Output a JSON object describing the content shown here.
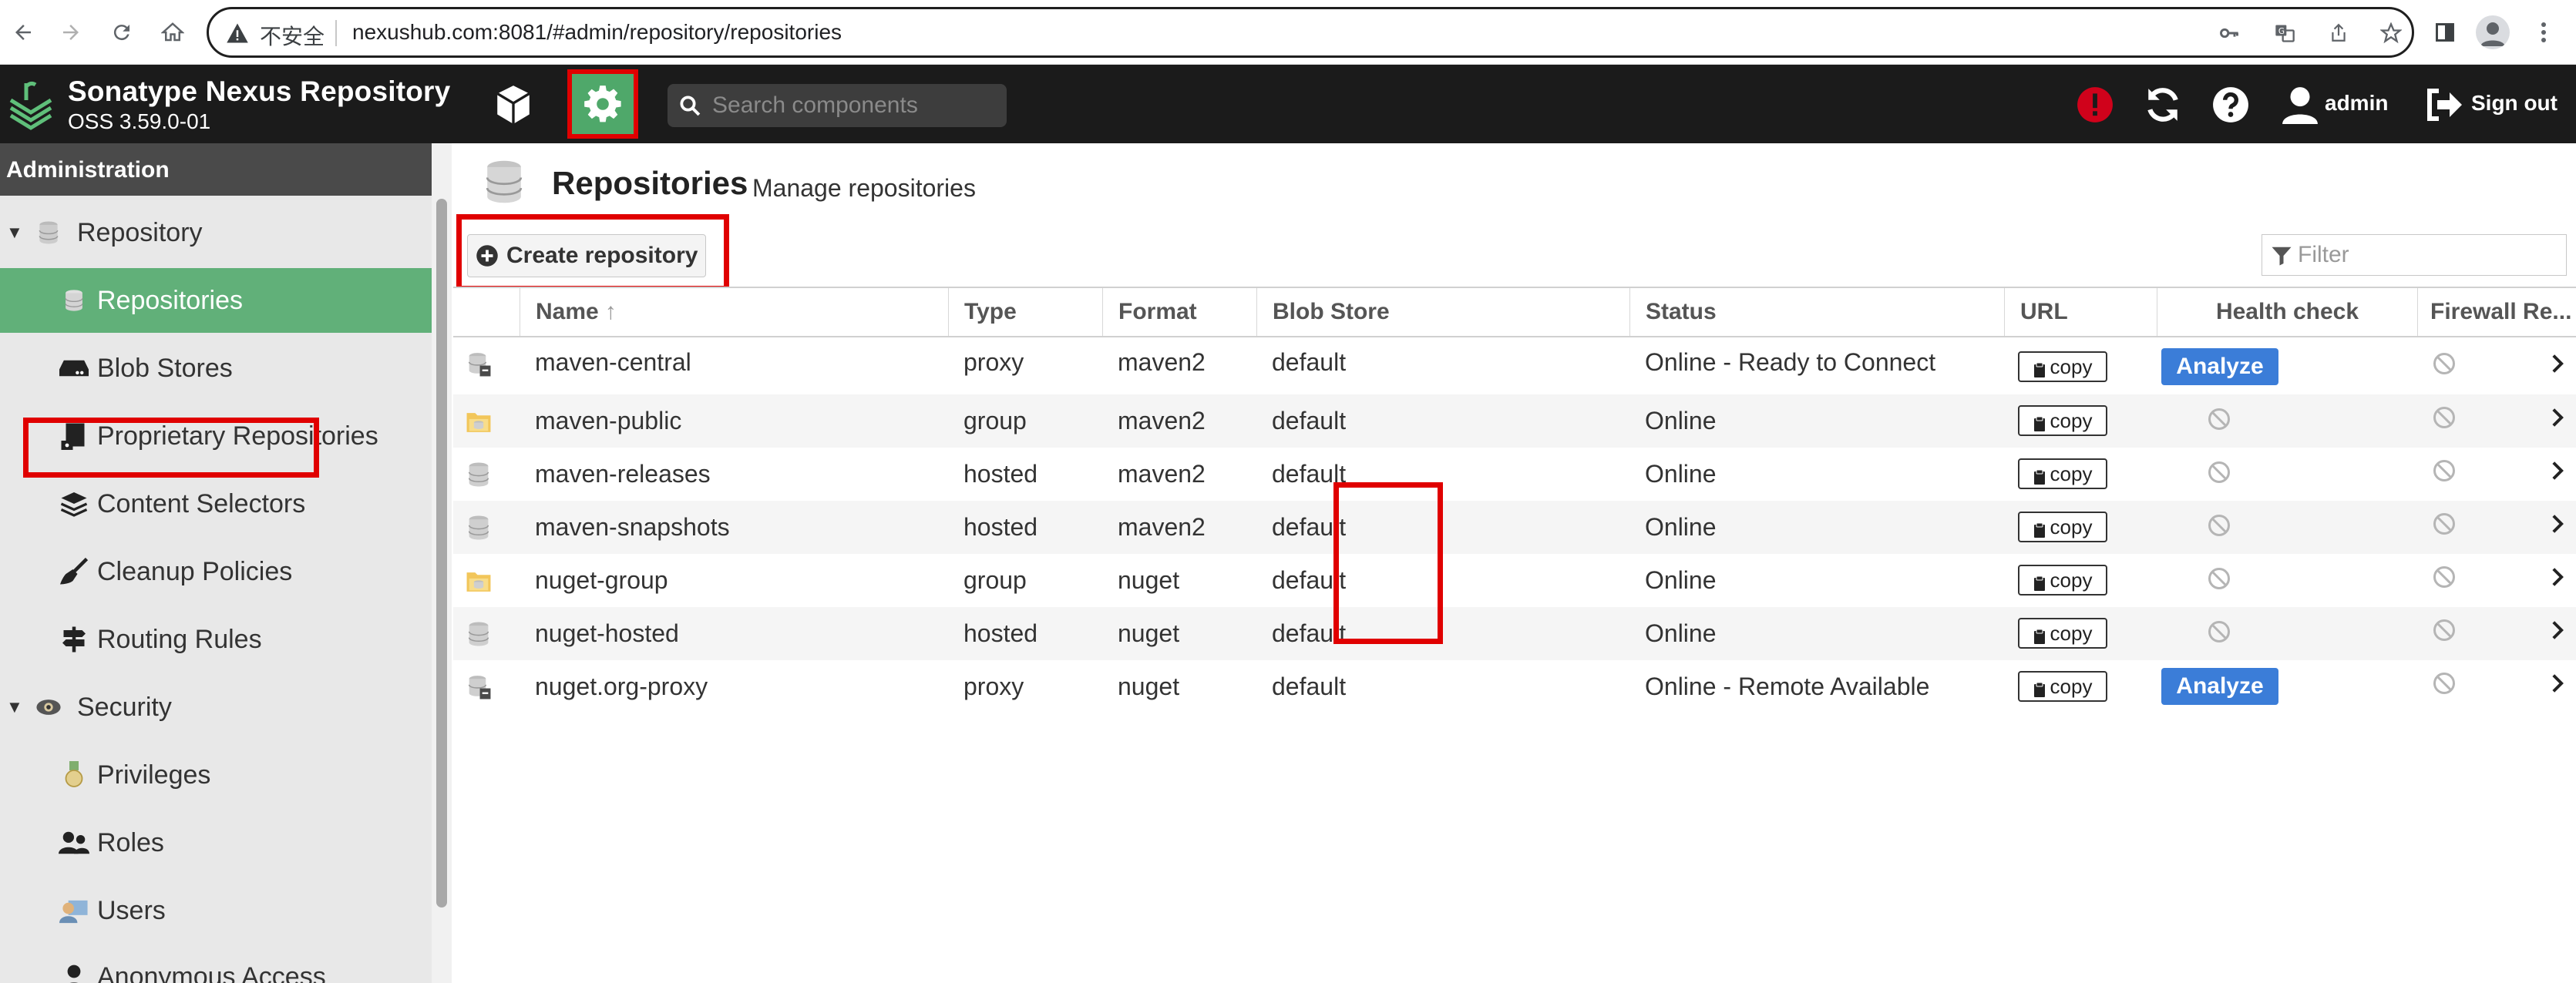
{
  "browser": {
    "insecure_label": "不安全",
    "url": "nexushub.com:8081/#admin/repository/repositories"
  },
  "app": {
    "brand": "Sonatype Nexus Repository",
    "version": "OSS 3.59.0-01",
    "search_placeholder": "Search components",
    "user": "admin",
    "sign_out": "Sign out"
  },
  "sidebar": {
    "title": "Administration",
    "groups": [
      {
        "label": "Repository",
        "items": [
          {
            "label": "Repositories",
            "icon": "database-icon",
            "active": true
          },
          {
            "label": "Blob Stores",
            "icon": "hard-drive-icon"
          },
          {
            "label": "Proprietary Repositories",
            "icon": "proprietary-icon"
          },
          {
            "label": "Content Selectors",
            "icon": "layers-icon"
          },
          {
            "label": "Cleanup Policies",
            "icon": "broom-icon"
          },
          {
            "label": "Routing Rules",
            "icon": "signpost-icon"
          }
        ]
      },
      {
        "label": "Security",
        "items": [
          {
            "label": "Privileges",
            "icon": "medal-icon"
          },
          {
            "label": "Roles",
            "icon": "users-icon"
          },
          {
            "label": "Users",
            "icon": "user-card-icon"
          },
          {
            "label": "Anonymous Access",
            "icon": "user-icon"
          }
        ]
      }
    ]
  },
  "page": {
    "title": "Repositories",
    "subtitle": "Manage repositories",
    "create_label": "Create repository",
    "filter_placeholder": "Filter"
  },
  "grid": {
    "columns": [
      "Name",
      "Type",
      "Format",
      "Blob Store",
      "Status",
      "URL",
      "Health check",
      "Firewall Re..."
    ],
    "sort_indicator": "↑",
    "copy_label": "copy",
    "analyze_label": "Analyze",
    "rows": [
      {
        "name": "maven-central",
        "type": "proxy",
        "format": "maven2",
        "blob_store": "default",
        "status": "Online - Ready to Connect",
        "health": "analyze",
        "kind": "proxy"
      },
      {
        "name": "maven-public",
        "type": "group",
        "format": "maven2",
        "blob_store": "default",
        "status": "Online",
        "health": "none",
        "kind": "group"
      },
      {
        "name": "maven-releases",
        "type": "hosted",
        "format": "maven2",
        "blob_store": "default",
        "status": "Online",
        "health": "none",
        "kind": "hosted"
      },
      {
        "name": "maven-snapshots",
        "type": "hosted",
        "format": "maven2",
        "blob_store": "default",
        "status": "Online",
        "health": "none",
        "kind": "hosted"
      },
      {
        "name": "nuget-group",
        "type": "group",
        "format": "nuget",
        "blob_store": "default",
        "status": "Online",
        "health": "none",
        "kind": "group"
      },
      {
        "name": "nuget-hosted",
        "type": "hosted",
        "format": "nuget",
        "blob_store": "default",
        "status": "Online",
        "health": "none",
        "kind": "hosted"
      },
      {
        "name": "nuget.org-proxy",
        "type": "proxy",
        "format": "nuget",
        "blob_store": "default",
        "status": "Online - Remote Available",
        "health": "analyze",
        "kind": "proxy"
      }
    ]
  },
  "colors": {
    "accent_green": "#61b079",
    "admin_active": "#4fa86a",
    "annotation_red": "#e00000",
    "analyze_blue": "#3b7dd8",
    "alert_red": "#d0021b"
  }
}
